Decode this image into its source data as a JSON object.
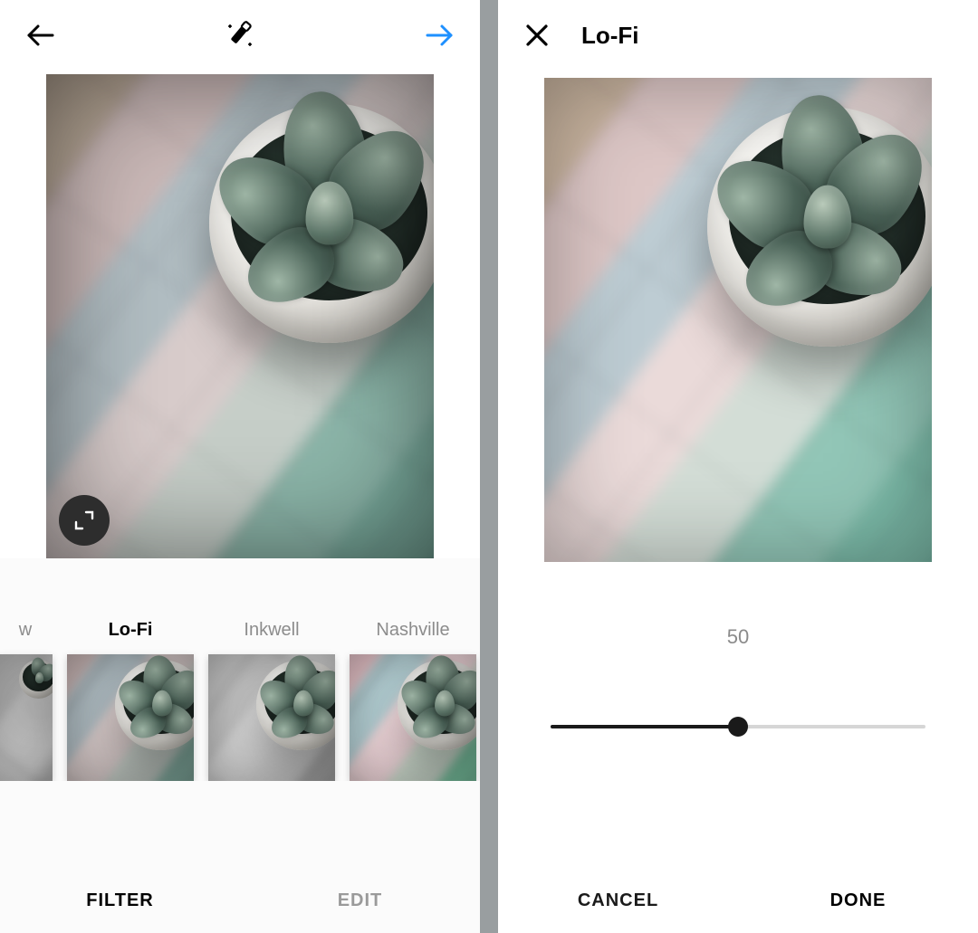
{
  "left": {
    "header": {
      "back_icon": "arrow-left",
      "wand_icon": "magic-wand",
      "next_icon": "arrow-right"
    },
    "filters": {
      "items": [
        {
          "label": "w",
          "style": "partial",
          "selected": false
        },
        {
          "label": "Lo-Fi",
          "style": "lofi",
          "selected": true
        },
        {
          "label": "Inkwell",
          "style": "bw",
          "selected": false
        },
        {
          "label": "Nashville",
          "style": "nash",
          "selected": false
        }
      ]
    },
    "tabs": {
      "filter": "FILTER",
      "edit": "EDIT",
      "active": "filter"
    }
  },
  "right": {
    "header": {
      "close_icon": "close",
      "title": "Lo-Fi"
    },
    "slider": {
      "value": 50,
      "min": 0,
      "max": 100
    },
    "actions": {
      "cancel": "CANCEL",
      "done": "DONE"
    }
  },
  "colors": {
    "accent_blue": "#1e90ff"
  }
}
